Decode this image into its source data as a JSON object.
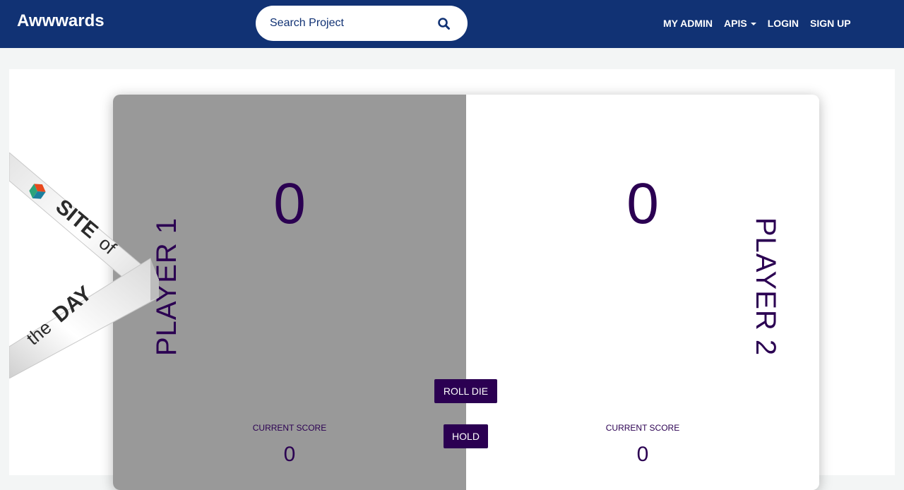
{
  "navbar": {
    "brand": "Awwwards",
    "search": {
      "placeholder": "Search Project",
      "icon": "search-icon"
    },
    "links": [
      {
        "label": "MY ADMIN",
        "dropdown": false
      },
      {
        "label": "APIS",
        "dropdown": true
      },
      {
        "label": "LOGIN",
        "dropdown": false
      },
      {
        "label": "SIGN UP",
        "dropdown": false
      }
    ]
  },
  "badge": {
    "text": "SITE of the DAY"
  },
  "game": {
    "player1": {
      "name": "PLAYER 1",
      "score": "0",
      "current_label": "CURRENT SCORE",
      "current_score": "0"
    },
    "player2": {
      "name": "PLAYER 2",
      "score": "0",
      "current_label": "CURRENT SCORE",
      "current_score": "0"
    },
    "roll_label": "ROLL DIE",
    "hold_label": "HOLD"
  },
  "colors": {
    "navbar": "#113274",
    "active_panel": "#999999",
    "text_dark": "#2b0052",
    "button": "#2b0052"
  }
}
